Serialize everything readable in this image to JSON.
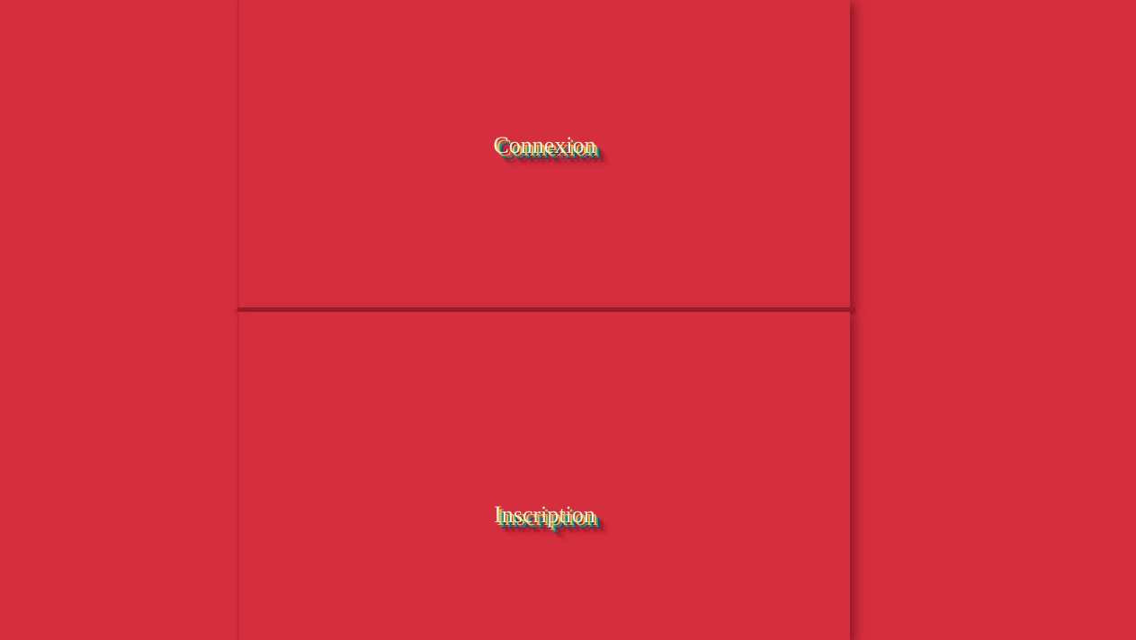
{
  "menu": {
    "login_label": "Connexion",
    "signup_label": "Inscription"
  },
  "colors": {
    "background": "#d52e3f",
    "divider": "#9e1b2a",
    "label_text": "#fbeed2",
    "label_shadow_yellow": "#e4c04a",
    "label_shadow_teal": "#2c8f86",
    "label_shadow_navy": "#1b4f64"
  }
}
